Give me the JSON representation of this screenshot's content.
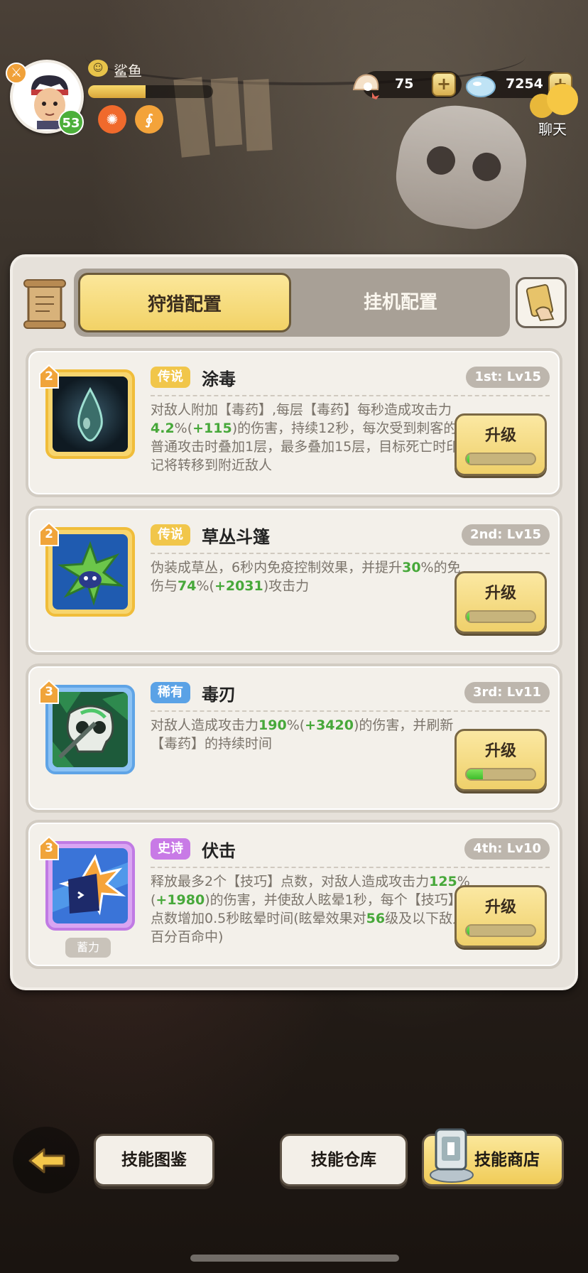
{
  "player": {
    "name": "鲨鱼",
    "level": "53",
    "xp_fraction": 0.46
  },
  "resources": {
    "shells": "75",
    "gems": "7254"
  },
  "chat": {
    "label": "聊天"
  },
  "tabs": {
    "hunt": "狩猎配置",
    "idle": "挂机配置",
    "active": "hunt"
  },
  "skills": [
    {
      "stars": "2",
      "rarity": "传说",
      "name": "涂毒",
      "rank": "1st: Lv15",
      "desc": [
        {
          "t": "对敌人附加【毒药】,每层【毒药】每秒造成攻击力"
        },
        {
          "t": "4.2",
          "hl": true
        },
        {
          "t": "%("
        },
        {
          "t": "+115",
          "hl": true
        },
        {
          "t": ")的伤害，持续12秒，每次受到刺客的普通攻击时叠加1层，最多叠加15层，目标死亡时印记将转移到附近敌人"
        }
      ],
      "upgrade_label": "升级",
      "progress": 0.02
    },
    {
      "stars": "2",
      "rarity": "传说",
      "name": "草丛斗篷",
      "rank": "2nd: Lv15",
      "desc": [
        {
          "t": "伪装成草丛，6秒内免疫控制效果，并提升"
        },
        {
          "t": "30",
          "hl": true
        },
        {
          "t": "%的免伤与"
        },
        {
          "t": "74",
          "hl": true
        },
        {
          "t": "%("
        },
        {
          "t": "+2031",
          "hl": true
        },
        {
          "t": ")攻击力"
        }
      ],
      "upgrade_label": "升级",
      "progress": 0.02
    },
    {
      "stars": "3",
      "rarity": "稀有",
      "name": "毒刃",
      "rank": "3rd: Lv11",
      "desc": [
        {
          "t": "对敌人造成攻击力"
        },
        {
          "t": "190",
          "hl": true
        },
        {
          "t": "%("
        },
        {
          "t": "+3420",
          "hl": true
        },
        {
          "t": ")的伤害，并刷新【毒药】的持续时间"
        }
      ],
      "upgrade_label": "升级",
      "progress": 0.24
    },
    {
      "stars": "3",
      "rarity": "史诗",
      "name": "伏击",
      "rank": "4th: Lv10",
      "tag": "蓄力",
      "desc": [
        {
          "t": "释放最多2个【技巧】点数，对敌人造成攻击力"
        },
        {
          "t": "125",
          "hl": true
        },
        {
          "t": "%("
        },
        {
          "t": "+1980",
          "hl": true
        },
        {
          "t": ")的伤害，并使敌人眩晕1秒，每个【技巧】点数增加0.5秒眩晕时间(眩晕效果对"
        },
        {
          "t": "56",
          "hl": true
        },
        {
          "t": "级及以下敌人百分百命中)"
        }
      ],
      "upgrade_label": "升级",
      "progress": 0.02
    }
  ],
  "bottom": {
    "atlas": "技能图鉴",
    "storage": "技能仓库",
    "shop": "技能商店"
  },
  "colors": {
    "accent_gold": "#f2d266",
    "highlight_green": "#47a83a",
    "legend": "#f1c64a",
    "rare": "#5aa2e6",
    "epic": "#c87ae6"
  }
}
